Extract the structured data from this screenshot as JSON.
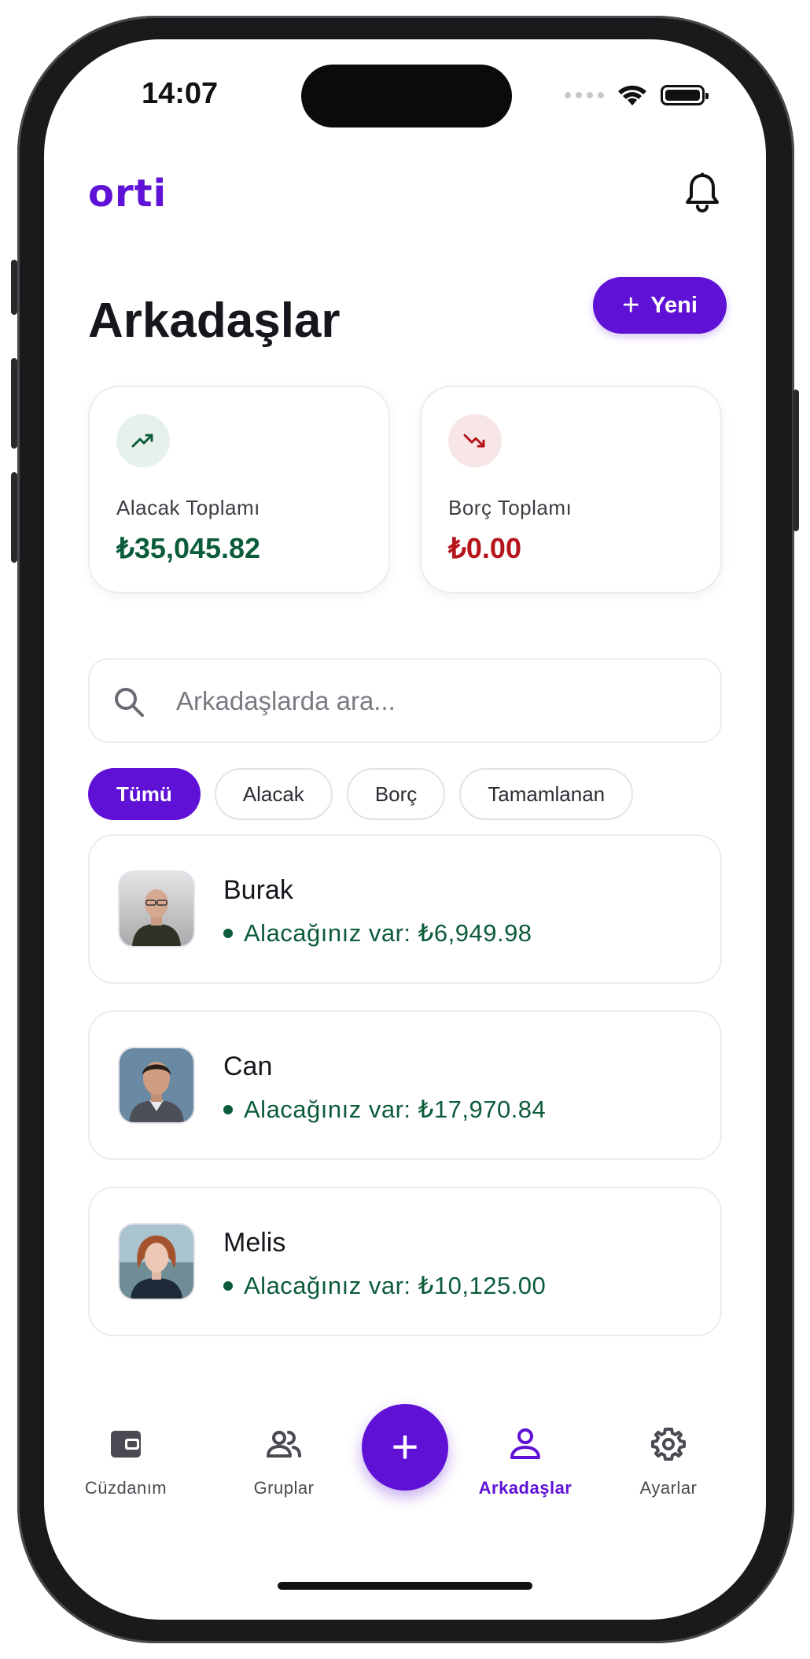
{
  "colors": {
    "accent": "#5f12d6",
    "positive": "#0c5c3a",
    "negative": "#b5141a",
    "positive_bg": "#e7f1ec",
    "negative_bg": "#f8e6e6"
  },
  "status_bar": {
    "time": "14:07",
    "icons": [
      "signal-dots-icon",
      "wifi-icon",
      "battery-icon"
    ]
  },
  "header": {
    "logo": "orti",
    "notification_icon": "bell-icon"
  },
  "page": {
    "title": "Arkadaşlar",
    "new_button_label": "Yeni",
    "new_button_icon": "plus-icon"
  },
  "summary": {
    "receivable": {
      "label": "Alacak Toplamı",
      "value": "₺35,045.82",
      "icon": "trending-up-icon"
    },
    "debt": {
      "label": "Borç Toplamı",
      "value": "₺0.00",
      "icon": "trending-down-icon"
    }
  },
  "search": {
    "placeholder": "Arkadaşlarda ara...",
    "value": "",
    "icon": "search-icon"
  },
  "filters": [
    {
      "label": "Tümü",
      "active": true
    },
    {
      "label": "Alacak",
      "active": false
    },
    {
      "label": "Borç",
      "active": false
    },
    {
      "label": "Tamamlanan",
      "active": false
    }
  ],
  "friends": [
    {
      "name": "Burak",
      "status": "Alacağınız var: ₺6,949.98"
    },
    {
      "name": "Can",
      "status": "Alacağınız var: ₺17,970.84"
    },
    {
      "name": "Melis",
      "status": "Alacağınız var: ₺10,125.00"
    }
  ],
  "tabbar": {
    "items": [
      {
        "label": "Cüzdanım",
        "icon": "wallet-icon",
        "active": false
      },
      {
        "label": "Gruplar",
        "icon": "groups-icon",
        "active": false
      },
      {
        "label": "Arkadaşlar",
        "icon": "person-icon",
        "active": true
      },
      {
        "label": "Ayarlar",
        "icon": "gear-icon",
        "active": false
      }
    ],
    "fab_icon": "plus-icon"
  }
}
